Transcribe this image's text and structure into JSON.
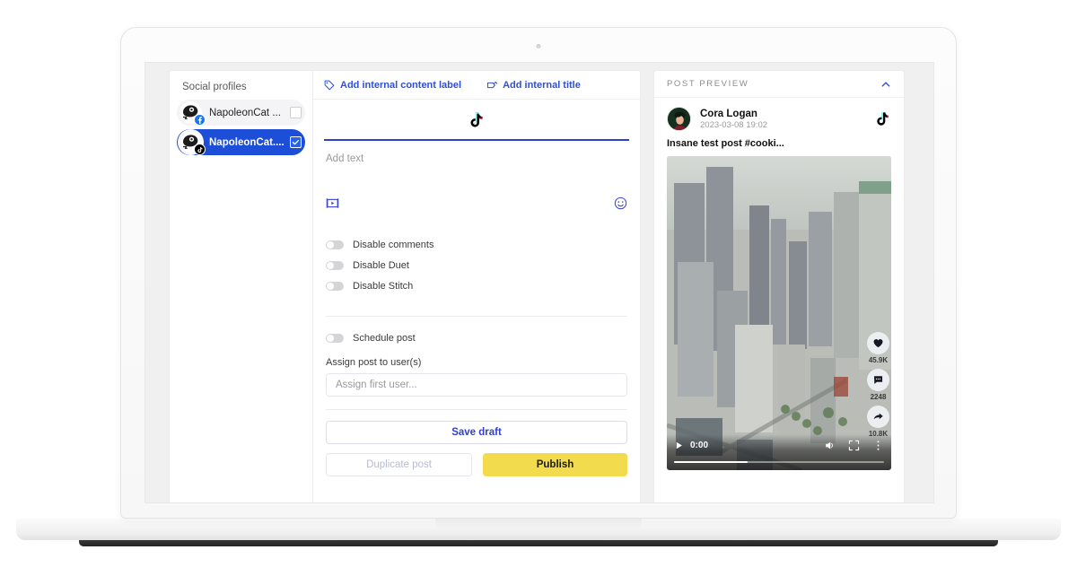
{
  "device": {
    "name": "laptop-mockup",
    "camera": "camera-dot"
  },
  "sidebar": {
    "title": "Social profiles",
    "profiles": [
      {
        "name": "NapoleonCat ...",
        "network": "facebook",
        "selected": false,
        "checked": false
      },
      {
        "name": "NapoleonCat....",
        "network": "tiktok",
        "selected": true,
        "checked": true
      }
    ]
  },
  "editor": {
    "top_actions": [
      {
        "label": "Add internal content label",
        "icon": "tag-icon"
      },
      {
        "label": "Add internal title",
        "icon": "label-upload-icon"
      }
    ],
    "active_network_tab": "tiktok",
    "caption_placeholder": "Add text",
    "attach": {
      "media_icon": "media-insert-icon",
      "emoji_icon": "emoji-icon"
    },
    "toggles": [
      {
        "label": "Disable comments",
        "on": false
      },
      {
        "label": "Disable Duet",
        "on": false
      },
      {
        "label": "Disable Stitch",
        "on": false
      }
    ],
    "schedule": {
      "label": "Schedule post",
      "on": false
    },
    "assign": {
      "label": "Assign post to user(s)",
      "placeholder": "Assign first user...",
      "value": ""
    },
    "buttons": {
      "save_draft": "Save draft",
      "duplicate": "Duplicate post",
      "publish": "Publish"
    },
    "accent_color": "#2f3fd0",
    "publish_color": "#f2db4c"
  },
  "preview": {
    "title": "POST PREVIEW",
    "collapse_icon": "chevron-up-icon",
    "network_icon": "tiktok-icon",
    "author": "Cora Logan",
    "date": "2023-03-08 19:02",
    "caption": "Insane test post #cooki...",
    "media": {
      "type": "video",
      "alt": "aerial city skyline"
    },
    "video_controls": {
      "play_icon": "play-icon",
      "time": "0:00",
      "volume_icon": "volume-icon",
      "fullscreen_icon": "fullscreen-icon",
      "more_icon": "kebab-menu-icon",
      "progress_percent": 35
    },
    "engagement": [
      {
        "icon": "heart-icon",
        "count": "45.9K"
      },
      {
        "icon": "comment-icon",
        "count": "2248"
      },
      {
        "icon": "share-icon",
        "count": "10.8K"
      }
    ]
  }
}
